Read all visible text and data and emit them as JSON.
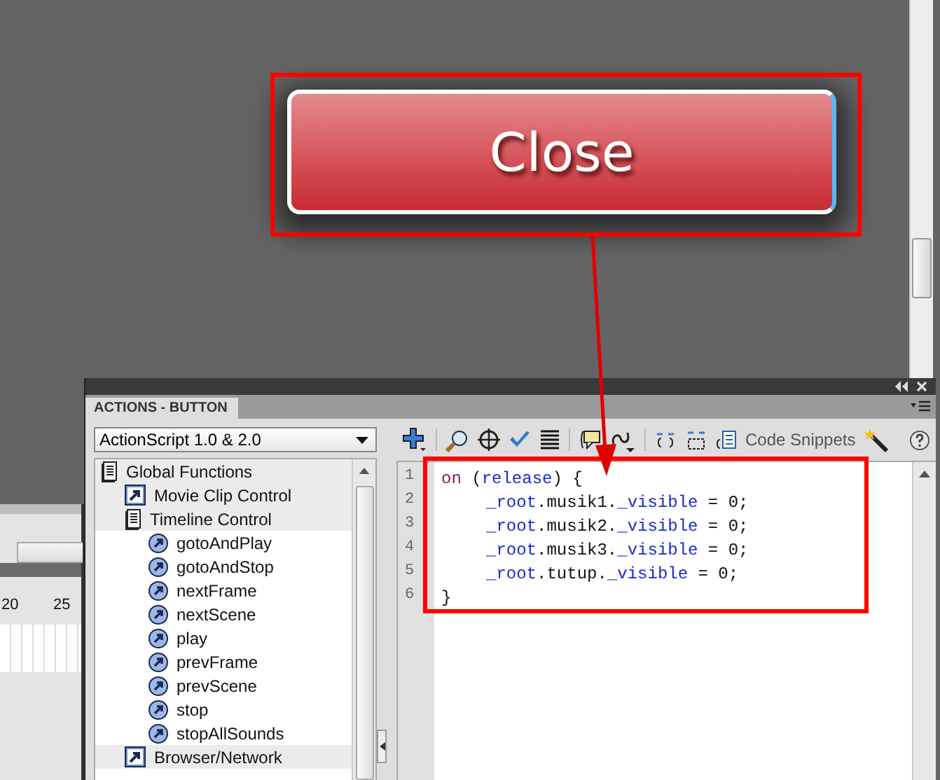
{
  "stage": {
    "button_label": "Close"
  },
  "timeline": {
    "frame_labels": [
      "20",
      "25"
    ]
  },
  "actions_panel": {
    "tab": {
      "label": "ACTIONS - BUTTON",
      "selected": true
    },
    "language": "ActionScript 1.0 & 2.0",
    "tree": [
      {
        "label": "Global Functions",
        "kind": "book",
        "children": [
          {
            "label": "Movie Clip Control",
            "kind": "category"
          },
          {
            "label": "Timeline Control",
            "kind": "book",
            "children": [
              {
                "label": "gotoAndPlay",
                "kind": "function"
              },
              {
                "label": "gotoAndStop",
                "kind": "function"
              },
              {
                "label": "nextFrame",
                "kind": "function"
              },
              {
                "label": "nextScene",
                "kind": "function"
              },
              {
                "label": "play",
                "kind": "function"
              },
              {
                "label": "prevFrame",
                "kind": "function"
              },
              {
                "label": "prevScene",
                "kind": "function"
              },
              {
                "label": "stop",
                "kind": "function"
              },
              {
                "label": "stopAllSounds",
                "kind": "function"
              }
            ]
          },
          {
            "label": "Browser/Network",
            "kind": "category"
          }
        ]
      }
    ],
    "code_snippets_label": "Code Snippets",
    "code": [
      {
        "number": "1",
        "indented": false,
        "tokens": [
          {
            "text": "on",
            "kind": "keyword"
          },
          {
            "text": " (",
            "kind": "plain"
          },
          {
            "text": "release",
            "kind": "builtin"
          },
          {
            "text": ") {",
            "kind": "plain"
          }
        ]
      },
      {
        "number": "2",
        "indented": true,
        "tokens": [
          {
            "text": "_root",
            "kind": "builtin"
          },
          {
            "text": ".musik1.",
            "kind": "plain"
          },
          {
            "text": "_visible",
            "kind": "builtin"
          },
          {
            "text": " = 0;",
            "kind": "plain"
          }
        ]
      },
      {
        "number": "3",
        "indented": true,
        "tokens": [
          {
            "text": "_root",
            "kind": "builtin"
          },
          {
            "text": ".musik2.",
            "kind": "plain"
          },
          {
            "text": "_visible",
            "kind": "builtin"
          },
          {
            "text": " = 0;",
            "kind": "plain"
          }
        ]
      },
      {
        "number": "4",
        "indented": true,
        "tokens": [
          {
            "text": "_root",
            "kind": "builtin"
          },
          {
            "text": ".musik3.",
            "kind": "plain"
          },
          {
            "text": "_visible",
            "kind": "builtin"
          },
          {
            "text": " = 0;",
            "kind": "plain"
          }
        ]
      },
      {
        "number": "5",
        "indented": true,
        "tokens": [
          {
            "text": "_root",
            "kind": "builtin"
          },
          {
            "text": ".tutup.",
            "kind": "plain"
          },
          {
            "text": "_visible",
            "kind": "builtin"
          },
          {
            "text": " = 0;",
            "kind": "plain"
          }
        ]
      },
      {
        "number": "6",
        "indented": false,
        "tokens": [
          {
            "text": "}",
            "kind": "plain"
          }
        ]
      }
    ]
  }
}
